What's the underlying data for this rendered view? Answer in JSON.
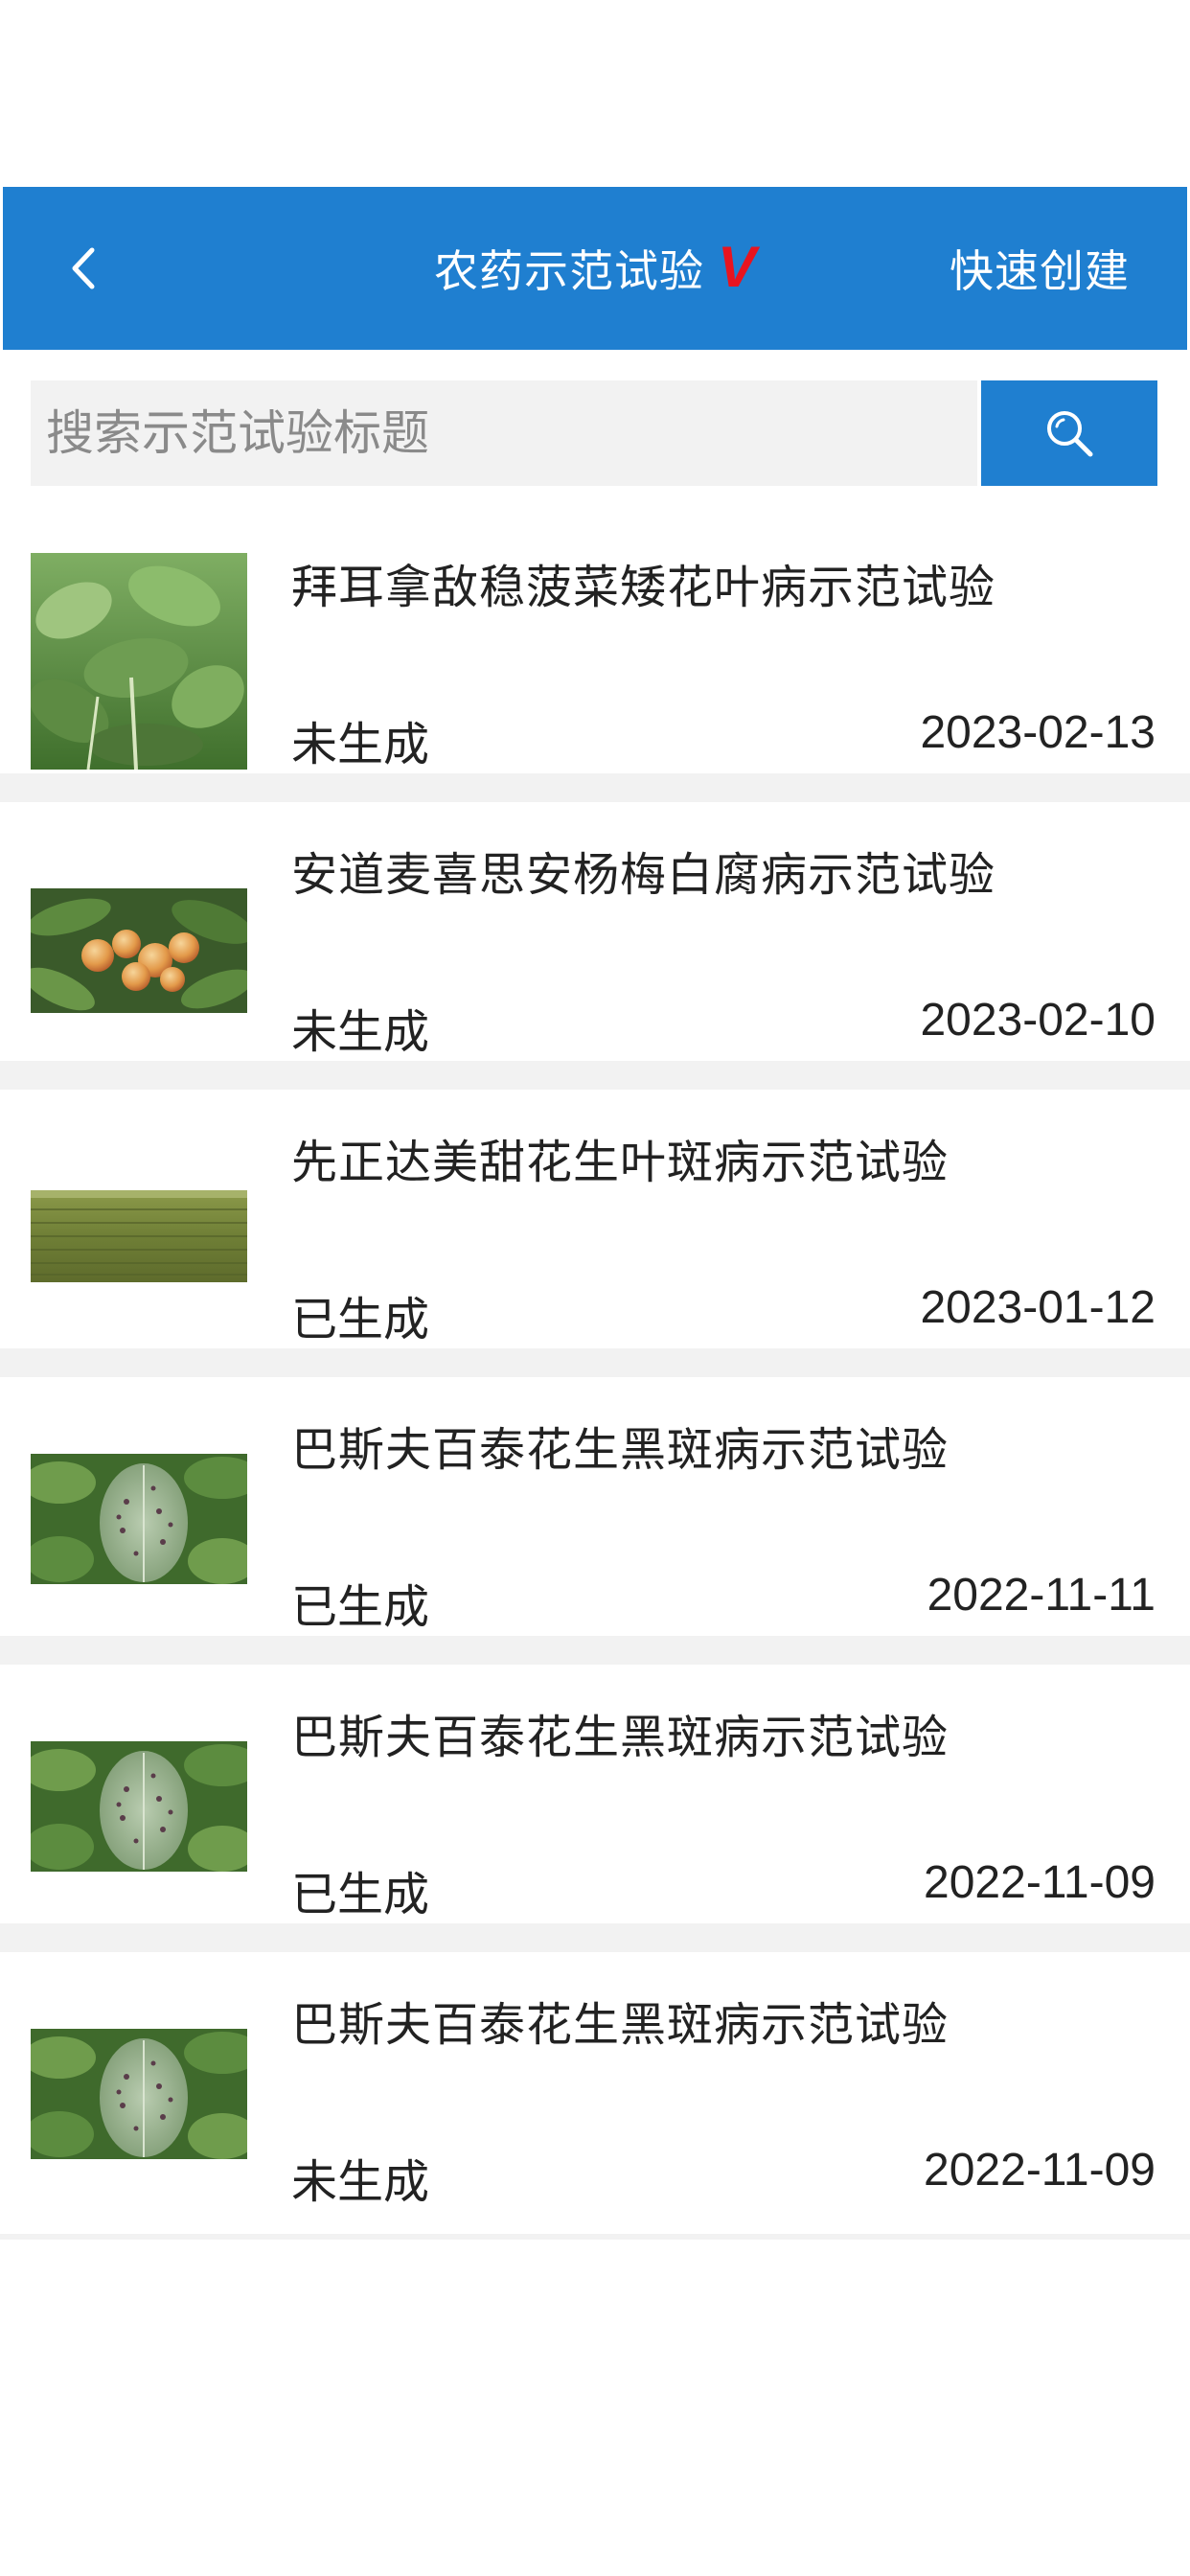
{
  "header": {
    "title": "农药示范试验",
    "title_mark": "V",
    "quick_create": "快速创建",
    "colors": {
      "bar": "#1f7fd0",
      "mark": "#e8141f"
    }
  },
  "search": {
    "placeholder": "搜索示范试验标题",
    "value": ""
  },
  "items": [
    {
      "title": "拜耳拿敌稳菠菜矮花叶病示范试验",
      "status": "未生成",
      "date": "2023-02-13",
      "image": "spinach-photo"
    },
    {
      "title": "安道麦喜思安杨梅白腐病示范试验",
      "status": "未生成",
      "date": "2023-02-10",
      "image": "bayberry-photo"
    },
    {
      "title": "先正达美甜花生叶斑病示范试验",
      "status": "已生成",
      "date": "2023-01-12",
      "image": "peanut-field-photo"
    },
    {
      "title": "巴斯夫百泰花生黑斑病示范试验",
      "status": "已生成",
      "date": "2022-11-11",
      "image": "leaf-spot-photo"
    },
    {
      "title": "巴斯夫百泰花生黑斑病示范试验",
      "status": "已生成",
      "date": "2022-11-09",
      "image": "leaf-spot-photo"
    },
    {
      "title": "巴斯夫百泰花生黑斑病示范试验",
      "status": "未生成",
      "date": "2022-11-09",
      "image": "leaf-spot-photo"
    }
  ]
}
